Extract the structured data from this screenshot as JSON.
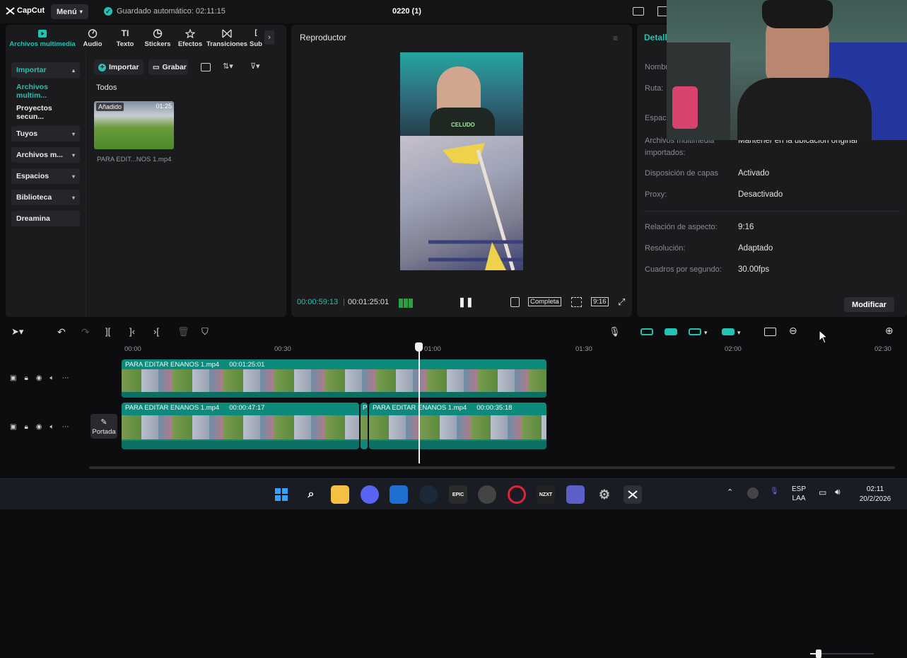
{
  "titlebar": {
    "app_name": "CapCut",
    "menu_label": "Menú",
    "autosave_text": "Guardado automático: 02:11:15",
    "project_name": "0220 (1)"
  },
  "media_tabs": [
    {
      "label": "Archivos multimedia",
      "icon": "media-icon",
      "active": true
    },
    {
      "label": "Audio",
      "icon": "audio-icon"
    },
    {
      "label": "Texto",
      "icon": "text-icon"
    },
    {
      "label": "Stickers",
      "icon": "sticker-icon"
    },
    {
      "label": "Efectos",
      "icon": "effects-icon"
    },
    {
      "label": "Transiciones",
      "icon": "transitions-icon"
    },
    {
      "label": "Sub",
      "icon": "subtitles-icon"
    }
  ],
  "sidebar": {
    "items": [
      {
        "label": "Importar",
        "active": true
      },
      {
        "label": "Archivos multim..."
      },
      {
        "label": "Proyectos secun..."
      },
      {
        "label": "Tuyos"
      },
      {
        "label": "Archivos m..."
      },
      {
        "label": "Espacios"
      },
      {
        "label": "Biblioteca"
      },
      {
        "label": "Dreamina"
      }
    ]
  },
  "media_toolbar": {
    "import_label": "Importar",
    "record_label": "Grabar"
  },
  "media_section": {
    "heading": "Todos",
    "item": {
      "badge": "Añadido",
      "duration": "01:25",
      "filename": "PARA EDIT...NOS 1.mp4"
    }
  },
  "player": {
    "title": "Reproductor",
    "video_caption": "CELUDO",
    "current_time": "00:00:59:13",
    "total_time": "00:01:25:01",
    "full_label": "Completa",
    "ratio_label": "9:16"
  },
  "details": {
    "title": "Detall",
    "rows": [
      {
        "label": "Nombre:",
        "value": ""
      },
      {
        "label": "Ruta:",
        "value": ""
      },
      {
        "label": "Espac",
        "value": ""
      },
      {
        "label": "Archivos multimedia importados:",
        "value": "Mantener en la ubicación original"
      },
      {
        "label": "Disposición de capas",
        "value": "Activado"
      },
      {
        "label": "Proxy:",
        "value": "Desactivado"
      },
      {
        "label": "Relación de aspecto:",
        "value": "9:16"
      },
      {
        "label": "Resolución:",
        "value": "Adaptado"
      },
      {
        "label": "Cuadros por segundo:",
        "value": "30.00fps"
      }
    ],
    "modify_label": "Modificar"
  },
  "timeline": {
    "ruler": [
      "00:00",
      "00:30",
      "01:00",
      "01:30",
      "02:00",
      "02:30"
    ],
    "track1_clip": {
      "name": "PARA EDITAR ENANOS 1.mp4",
      "duration": "00:01:25:01"
    },
    "track2_clips": [
      {
        "name": "PARA EDITAR ENANOS 1.mp4",
        "duration": "00:00:47:17"
      },
      {
        "name": "P",
        "duration": ""
      },
      {
        "name": "PARA EDITAR ENANOS 1.mp4",
        "duration": "00:00:35:18"
      }
    ],
    "cover_label": "Portada"
  },
  "taskbar": {
    "apps": [
      "windows-icon",
      "search-icon",
      "file-explorer-icon",
      "discord-icon",
      "store-icon",
      "steam-icon",
      "epic-games-icon",
      "chrome-icon",
      "opera-icon",
      "nzxt-icon",
      "teams-icon",
      "settings-icon",
      "capcut-icon"
    ],
    "lang_top": "ESP",
    "lang_bottom": "LAA",
    "time": "02:11",
    "date": "20/2/2026"
  },
  "colors": {
    "accent": "#22c3b3",
    "clip": "#0e8a7c",
    "panel": "#1b1b1e",
    "background": "#0d0d0f"
  }
}
